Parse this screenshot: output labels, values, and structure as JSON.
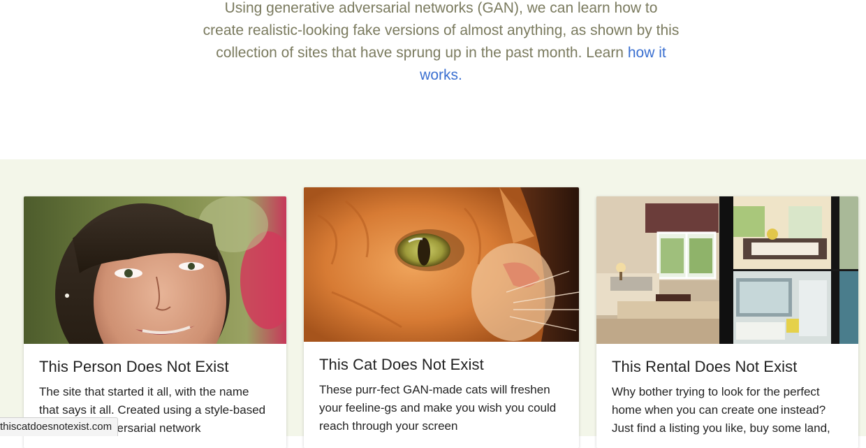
{
  "intro": {
    "text": "Using generative adversarial networks (GAN), we can learn how to create realistic-looking fake versions of almost anything, as shown by this collection of sites that have sprung up in the past month. Learn",
    "link_label": "how it works."
  },
  "cards": [
    {
      "title": "This Person Does Not Exist",
      "description": "The site that started it all, with the name that says it all. Created using a style-based generative adversarial network"
    },
    {
      "title": "This Cat Does Not Exist",
      "description": "These purr-fect GAN-made cats will freshen your feeline-gs and make you wish you could reach through your screen"
    },
    {
      "title": "This Rental Does Not Exist",
      "description": "Why bother trying to look for the perfect home when you can create one instead? Just find a listing you like, buy some land,"
    }
  ],
  "status_bar": {
    "url": "thiscatdoesnotexist.com"
  },
  "colors": {
    "band_background": "#f3f6e9",
    "intro_text": "#7a7a5e",
    "link": "#3a6fd0"
  }
}
